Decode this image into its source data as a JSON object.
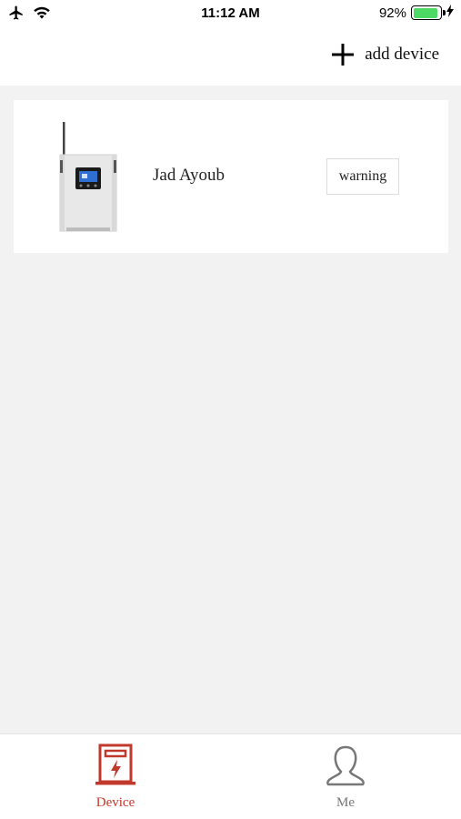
{
  "status_bar": {
    "time": "11:12 AM",
    "battery_percent": "92%",
    "battery_level": 0.92,
    "icons": [
      "airplane-icon",
      "wifi-icon",
      "battery-icon",
      "charging-icon"
    ]
  },
  "nav": {
    "add_device_label": "add device"
  },
  "devices": [
    {
      "name": "Jad Ayoub",
      "status": "warning"
    }
  ],
  "tabs": [
    {
      "label": "Device",
      "icon": "device-icon",
      "active": true
    },
    {
      "label": "Me",
      "icon": "person-icon",
      "active": false
    }
  ],
  "colors": {
    "accent": "#c0392b",
    "background": "#f2f2f2",
    "battery_green": "#4cd964"
  }
}
